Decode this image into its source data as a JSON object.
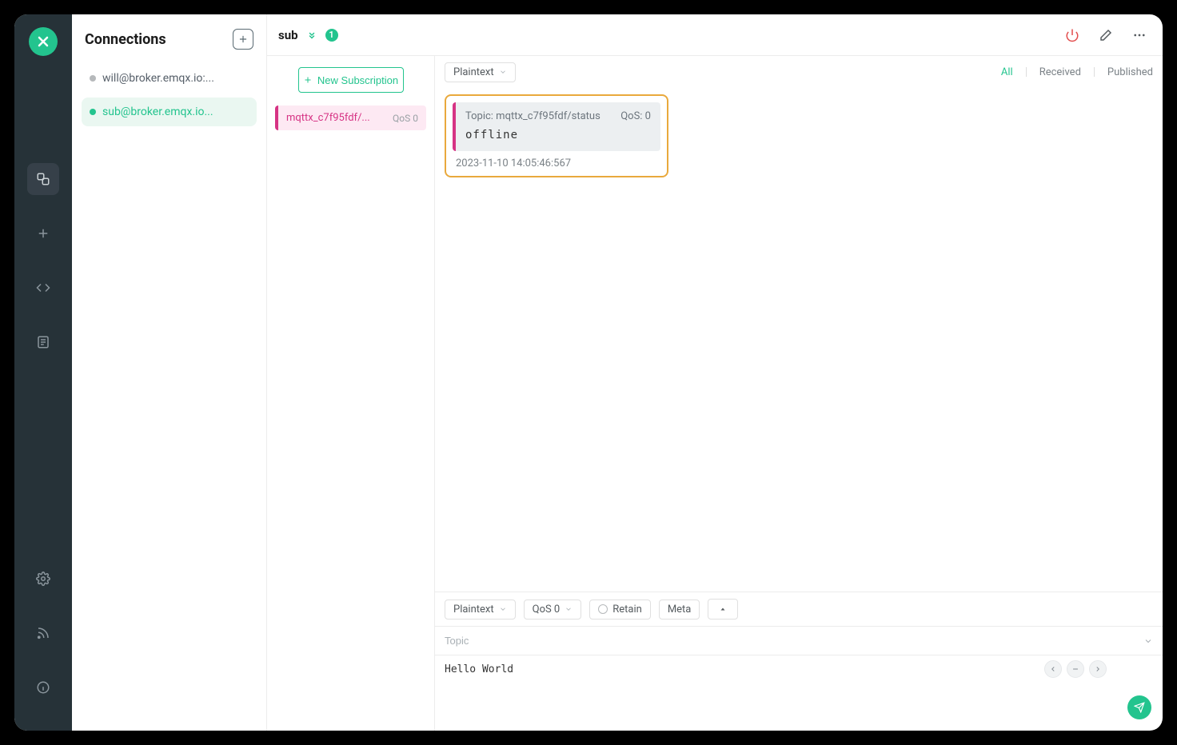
{
  "sidebar": {
    "title": "Connections",
    "items": [
      {
        "label": "will@broker.emqx.io:...",
        "status": "grey",
        "active": false
      },
      {
        "label": "sub@broker.emqx.io...",
        "status": "green",
        "active": true
      }
    ]
  },
  "nav": {
    "connections_icon": "connections-icon",
    "new_icon": "plus-icon",
    "code_icon": "code-icon",
    "log_icon": "log-icon",
    "settings_icon": "gear-icon",
    "rss_icon": "rss-icon",
    "info_icon": "info-icon"
  },
  "header": {
    "connection_name": "sub",
    "badge_count": "1"
  },
  "subscriptions": {
    "new_sub_label": "New Subscription",
    "items": [
      {
        "topic": "mqttx_c7f95fdf/...",
        "qos": "QoS 0"
      }
    ]
  },
  "toolbar": {
    "format_select": "Plaintext",
    "filters": {
      "all": "All",
      "received": "Received",
      "published": "Published"
    }
  },
  "messages": [
    {
      "topic_label": "Topic: mqttx_c7f95fdf/status",
      "qos_label": "QoS: 0",
      "payload": "offline",
      "timestamp": "2023-11-10 14:05:46:567"
    }
  ],
  "compose": {
    "format_select": "Plaintext",
    "qos_select": "QoS 0",
    "retain_label": "Retain",
    "meta_label": "Meta",
    "topic_placeholder": "Topic",
    "payload_value": "Hello World"
  }
}
